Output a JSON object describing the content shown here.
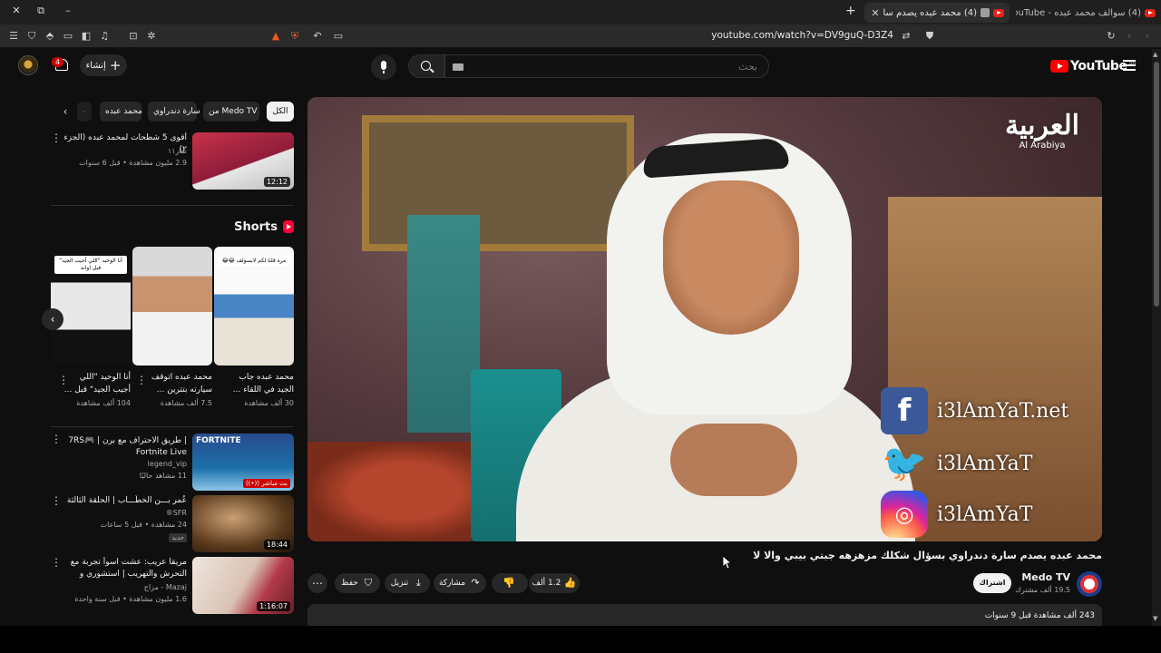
{
  "browser": {
    "active_tab_title": "(4) محمد عبده يصدم سارة دندراوي",
    "inactive_tab_title": "(4) سوالف محمد عبده - YouTube",
    "url": "youtube.com/watch?v=DV9guQ-D3Z4",
    "minimize_glyph": "–",
    "restore_glyph": "⧉",
    "close_glyph": "✕",
    "new_tab_glyph": "+"
  },
  "header": {
    "logo_text": "YouTube",
    "country_code": "SA",
    "search_placeholder": "بحث",
    "create_label": "إنشاء",
    "notification_count": "4"
  },
  "player": {
    "watermark_text": "العربية",
    "watermark_sub": "Al Arabiya",
    "social_lines": [
      {
        "icon": "f",
        "text": "i3lAmYaT.net"
      },
      {
        "icon": "🐦",
        "text": "i3lAmYaT"
      },
      {
        "icon": "◎",
        "text": "i3lAmYaT"
      }
    ]
  },
  "video": {
    "title": "محمد عبده يصدم سارة دندراوي بسؤال شكلك مزهزهه جبتي بيبي والا لا",
    "channel_name": "Medo TV",
    "channel_subs": "19.5 ألف مشترك",
    "subscribe_label": "اشتراك",
    "likes": "1.2 ألف",
    "share_label": "مشاركة",
    "download_label": "تنزيل",
    "save_label": "حفظ",
    "description_meta": "243 ألف مشاهدة  قبل 9 سنوات"
  },
  "chips": {
    "all": "الكل",
    "from_channel": "من Medo TV",
    "chip3": "سارة دندراوي",
    "chip4": "محمد عبده"
  },
  "sidebar": {
    "item1": {
      "title": "أقوى 5 شطحات لمحمد عبده (الجزء ٢)",
      "channel": "نقار١١",
      "meta": "2.9 مليون مشاهدة • قبل 6 سنوات",
      "duration": "12:12"
    },
    "shorts_label": "Shorts",
    "shorts": [
      {
        "title": "محمد عبده جاب الجيد في اللقاء ...",
        "views": "30 ألف مشاهدة",
        "caption": "مره قلنا لكم لايسولف 😂😂"
      },
      {
        "title": "محمد عبده اتوقف سيارته بتترين ...",
        "views": "7.5 ألف مشاهدة",
        "caption": ""
      },
      {
        "title": "أنا الوحيد \"اللي أجيب الجيد\" قبل ...",
        "views": "104 ألف مشاهدة",
        "caption": "أنا الوحيد \"اللي أجيب الجيد\" قبل اوانه"
      }
    ],
    "item2": {
      "title": "| طريق الاحتراف مع برن | 7RS🎮 Fortnite Live",
      "channel": "legend_vip",
      "meta": "11 مشاهد حاليًا",
      "live": "بث مباشر ((•))"
    },
    "item3": {
      "title": "عُمر بـــن الخطّـــاب | الحلقة الثالثة",
      "channel": "SFR®",
      "meta": "24 مشاهدة • قبل 5 ساعات",
      "badge": "جديد",
      "duration": "18:44"
    },
    "item4": {
      "title": "مريقا عريب: عشت اسوأ تجربة مع التحرش والتهريب | استشوري و عمري 14 سنة",
      "channel": "Mazaj - مزاج",
      "meta": "1.6 مليون مشاهدة • قبل سنة واحدة",
      "duration": "1:16:07"
    }
  }
}
